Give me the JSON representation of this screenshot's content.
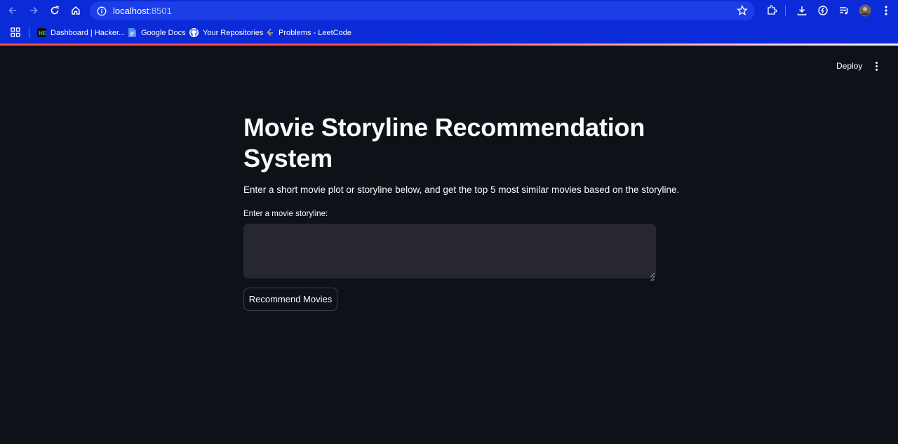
{
  "browser": {
    "url_host": "localhost",
    "url_port": ":8501",
    "bookmarks": [
      {
        "label": "Dashboard | Hacker...",
        "icon": "hackerrank-icon"
      },
      {
        "label": "Google Docs",
        "icon": "google-docs-icon"
      },
      {
        "label": "Your Repositories",
        "icon": "github-icon"
      },
      {
        "label": "Problems - LeetCode",
        "icon": "leetcode-icon"
      }
    ],
    "toolbar_color": "#0b2bd8"
  },
  "header": {
    "deploy_label": "Deploy"
  },
  "main": {
    "title": "Movie Storyline Recommendation System",
    "description": "Enter a short movie plot or storyline below, and get the top 5 most similar movies based on the storyline.",
    "input_label": "Enter a movie storyline:",
    "input_value": "",
    "button_label": "Recommend Movies"
  },
  "colors": {
    "background": "#0e1117",
    "input_background": "#262730",
    "accent": "#ff4b4b"
  }
}
